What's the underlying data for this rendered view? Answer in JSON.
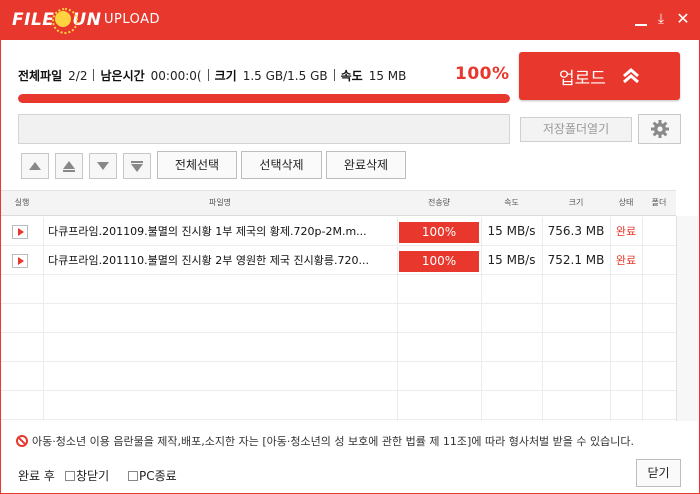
{
  "window": {
    "logo": {
      "left": "FILE",
      "right": "UN"
    },
    "subtitle": "UPLOAD",
    "controls": {
      "download": "⤓",
      "close": "✕"
    }
  },
  "summary": {
    "total_files_label": "전체파일",
    "total_files_value": "2/2",
    "remaining_label": "남은시간",
    "remaining_value": "00:00:0(",
    "size_label": "크기",
    "size_value": "1.5 GB/1.5 GB",
    "speed_label": "속도",
    "speed_value": "15 MB",
    "percent_text": "100%",
    "progress_fraction": 1.0
  },
  "actions": {
    "upload_label": "업로드",
    "open_folder_label": "저장폴더열기",
    "select_all": "전체선택",
    "delete_selected": "선택삭제",
    "delete_completed": "완료삭제"
  },
  "table": {
    "columns": [
      "실행",
      "파일명",
      "전송량",
      "속도",
      "크기",
      "상태",
      "폴더"
    ],
    "rows": [
      {
        "name": "다큐프라임.201109.불멸의 진시황 1부 제국의 황제.720p-2M.m...",
        "progress": "100%",
        "speed": "15 MB/s",
        "size": "756.3 MB",
        "status": "완료"
      },
      {
        "name": "다큐프라임.201110.불멸의 진시황 2부 영원한 제국 진시황릉.720...",
        "progress": "100%",
        "speed": "15 MB/s",
        "size": "752.1 MB",
        "status": "완료"
      }
    ]
  },
  "footer": {
    "warning": "아동·청소년 이용 음란물을 제작,배포,소지한 자는 [아동·청소년의 성 보호에 관한 법률 제 11조]에 따라 형사처벌 받을 수 있습니다.",
    "after_complete_label": "완료 후",
    "close_window_label": "창닫기",
    "pc_shutdown_label": "PC종료",
    "close_button": "닫기"
  },
  "colors": {
    "accent": "#e8372c"
  }
}
